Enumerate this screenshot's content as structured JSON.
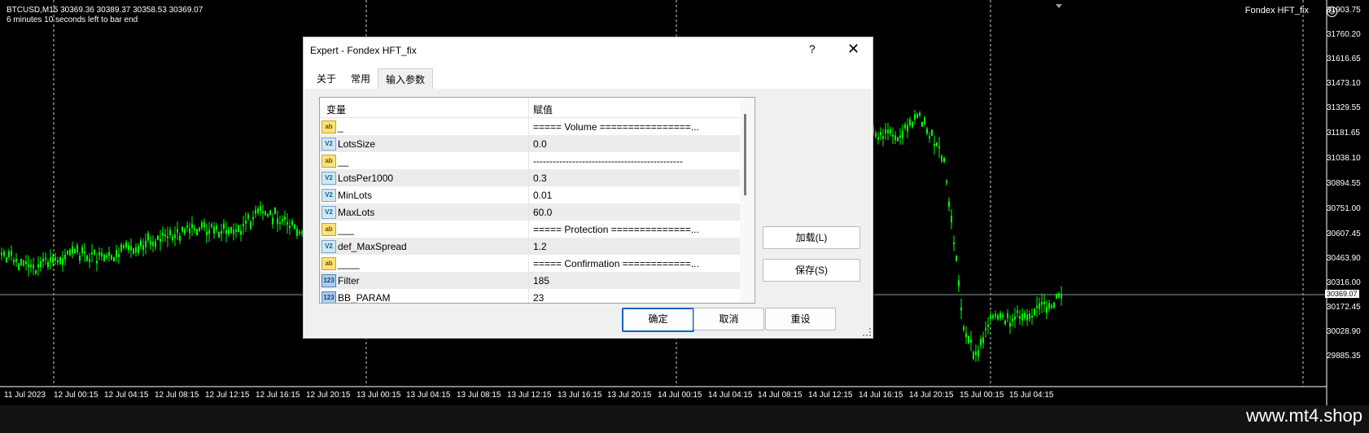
{
  "chart": {
    "symbol_line": "BTCUSD,M15  30369.36 30389.37 30358.53 30369.07",
    "countdown": "6 minutes 10 seconds left to bar end",
    "ea_label": "Fondex HFT_fix",
    "ea_status_icon": "smiley-icon",
    "current_price": "30369.07",
    "price_axis": [
      "31903.75",
      "31760.20",
      "31616.65",
      "31473.10",
      "31329.55",
      "31181.65",
      "31038.10",
      "30894.55",
      "30751.00",
      "30607.45",
      "30463.90",
      "30316.00",
      "30172.45",
      "30028.90",
      "29885.35"
    ],
    "time_axis": [
      "11 Jul 2023",
      "12 Jul 00:15",
      "12 Jul 04:15",
      "12 Jul 08:15",
      "12 Jul 12:15",
      "12 Jul 16:15",
      "12 Jul 20:15",
      "13 Jul 00:15",
      "13 Jul 04:15",
      "13 Jul 08:15",
      "13 Jul 12:15",
      "13 Jul 16:15",
      "13 Jul 20:15",
      "14 Jul 00:15",
      "14 Jul 04:15",
      "14 Jul 08:15",
      "14 Jul 12:15",
      "14 Jul 16:15",
      "14 Jul 20:15",
      "15 Jul 00:15",
      "15 Jul 04:15"
    ],
    "candle_color": "#00ff00",
    "background": "#000000"
  },
  "dialog": {
    "title": "Expert - Fondex HFT_fix",
    "help_label": "?",
    "close_label": "✕",
    "tabs": [
      {
        "label": "关于",
        "active": false
      },
      {
        "label": "常用",
        "active": false
      },
      {
        "label": "输入参数",
        "active": true
      }
    ],
    "grid": {
      "col_variable": "变量",
      "col_value": "赋值",
      "rows": [
        {
          "icon": "ab",
          "name": "_",
          "value": "===== Volume ================..."
        },
        {
          "icon": "v2",
          "name": "LotsSize",
          "value": "0.0"
        },
        {
          "icon": "ab",
          "name": "__",
          "value": "----------------------------------------------"
        },
        {
          "icon": "v2",
          "name": "LotsPer1000",
          "value": "0.3"
        },
        {
          "icon": "v2",
          "name": "MinLots",
          "value": "0.01"
        },
        {
          "icon": "v2",
          "name": "MaxLots",
          "value": "60.0"
        },
        {
          "icon": "ab",
          "name": "___",
          "value": "===== Protection ==============..."
        },
        {
          "icon": "v2",
          "name": "def_MaxSpread",
          "value": "1.2"
        },
        {
          "icon": "ab",
          "name": "____",
          "value": "===== Confirmation ============..."
        },
        {
          "icon": "123",
          "name": "Filter",
          "value": "185"
        },
        {
          "icon": "123",
          "name": "BB_PARAM",
          "value": "23"
        }
      ]
    },
    "load_button": "加载(L)",
    "save_button": "保存(S)",
    "ok_button": "确定",
    "cancel_button": "取消",
    "reset_button": "重设"
  },
  "watermark": "www.mt4.shop"
}
